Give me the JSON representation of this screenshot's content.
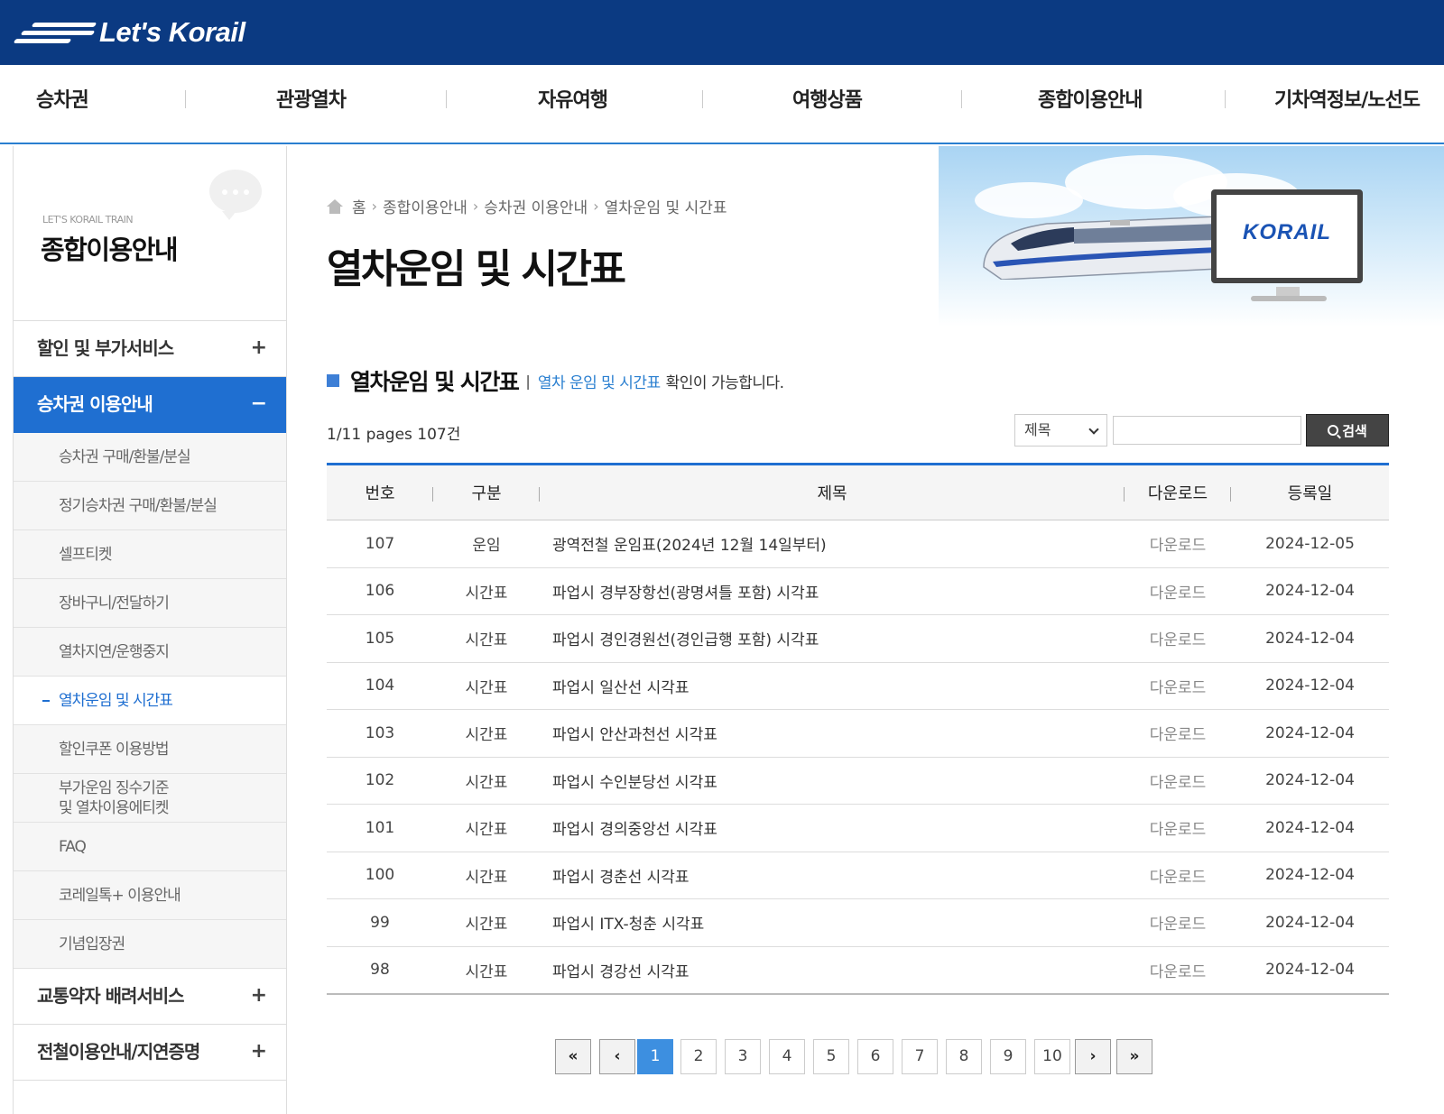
{
  "header": {
    "logo_text": "Let's Korail",
    "brand_color": "#0b3a82",
    "accent_color": "#1f6fd1"
  },
  "gnb": [
    "승차권",
    "관광열차",
    "자유여행",
    "여행상품",
    "종합이용안내",
    "기차역정보/노선도"
  ],
  "sidebar": {
    "subtitle": "LET'S KORAIL TRAIN",
    "title": "종합이용안내",
    "groups": [
      {
        "label": "할인 및 부가서비스",
        "toggle": "+"
      },
      {
        "label": "승차권 이용안내",
        "toggle": "−"
      },
      {
        "label": "교통약자 배려서비스",
        "toggle": "+"
      },
      {
        "label": "전철이용안내/지연증명",
        "toggle": "+"
      }
    ],
    "sub_items": [
      "승차권 구매/환불/분실",
      "정기승차권 구매/환불/분실",
      "셀프티켓",
      "장바구니/전달하기",
      "열차지연/운행중지",
      "열차운임 및 시간표",
      "할인쿠폰 이용방법",
      "부가운임 징수기준",
      "및 열차이용에티켓",
      "FAQ",
      "코레일톡+ 이용안내",
      "기념입장권"
    ]
  },
  "breadcrumb": [
    "홈",
    "종합이용안내",
    "승차권 이용안내",
    "열차운임 및 시간표"
  ],
  "page_title": "열차운임 및 시간표",
  "hero": {
    "monitor_text": "KORAIL",
    "icon": "train-illustration"
  },
  "section": {
    "title": "열차운임 및 시간표",
    "separator": "|",
    "link": "열차 운임 및 시간표",
    "desc": "확인이 가능합니다."
  },
  "list_info": "1/11 pages 107건",
  "search": {
    "select_value": "제목",
    "input_value": "",
    "button_label": "검색"
  },
  "table": {
    "headers": [
      "번호",
      "구분",
      "제목",
      "다운로드",
      "등록일"
    ],
    "rows": [
      [
        "107",
        "운임",
        "광역전철 운임표(2024년 12월 14일부터)",
        "다운로드",
        "2024-12-05"
      ],
      [
        "106",
        "시간표",
        "파업시 경부장항선(광명셔틀 포함) 시각표",
        "다운로드",
        "2024-12-04"
      ],
      [
        "105",
        "시간표",
        "파업시 경인경원선(경인급행 포함) 시각표",
        "다운로드",
        "2024-12-04"
      ],
      [
        "104",
        "시간표",
        "파업시 일산선 시각표",
        "다운로드",
        "2024-12-04"
      ],
      [
        "103",
        "시간표",
        "파업시 안산과천선 시각표",
        "다운로드",
        "2024-12-04"
      ],
      [
        "102",
        "시간표",
        "파업시 수인분당선 시각표",
        "다운로드",
        "2024-12-04"
      ],
      [
        "101",
        "시간표",
        "파업시 경의중앙선 시각표",
        "다운로드",
        "2024-12-04"
      ],
      [
        "100",
        "시간표",
        "파업시 경춘선 시각표",
        "다운로드",
        "2024-12-04"
      ],
      [
        "99",
        "시간표",
        "파업시 ITX-청춘 시각표",
        "다운로드",
        "2024-12-04"
      ],
      [
        "98",
        "시간표",
        "파업시 경강선 시각표",
        "다운로드",
        "2024-12-04"
      ]
    ]
  },
  "pagination": {
    "first": "«",
    "prev": "‹",
    "next": "›",
    "last": "»",
    "pages": [
      "1",
      "2",
      "3",
      "4",
      "5",
      "6",
      "7",
      "8",
      "9",
      "10"
    ],
    "current": "1"
  }
}
